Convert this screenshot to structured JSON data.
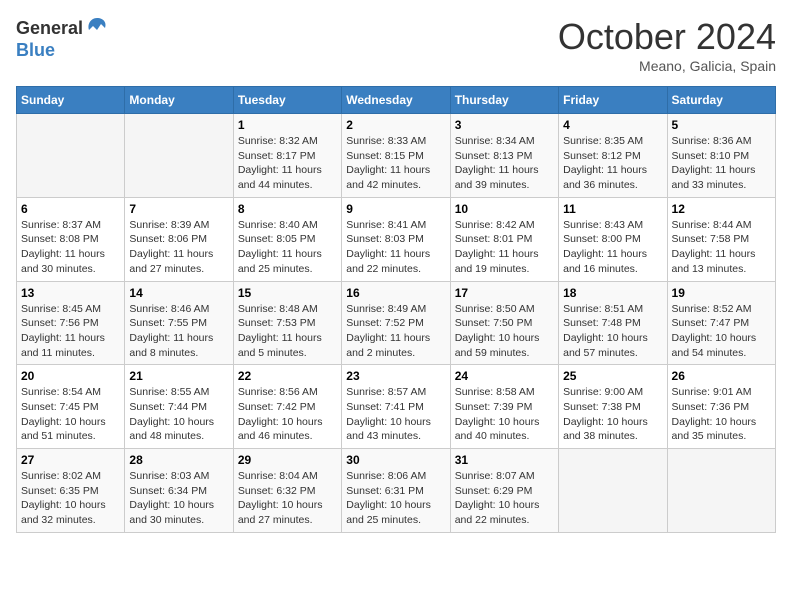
{
  "header": {
    "logo_general": "General",
    "logo_blue": "Blue",
    "month": "October 2024",
    "location": "Meano, Galicia, Spain"
  },
  "weekdays": [
    "Sunday",
    "Monday",
    "Tuesday",
    "Wednesday",
    "Thursday",
    "Friday",
    "Saturday"
  ],
  "weeks": [
    [
      {
        "day": "",
        "info": ""
      },
      {
        "day": "",
        "info": ""
      },
      {
        "day": "1",
        "info": "Sunrise: 8:32 AM\nSunset: 8:17 PM\nDaylight: 11 hours and 44 minutes."
      },
      {
        "day": "2",
        "info": "Sunrise: 8:33 AM\nSunset: 8:15 PM\nDaylight: 11 hours and 42 minutes."
      },
      {
        "day": "3",
        "info": "Sunrise: 8:34 AM\nSunset: 8:13 PM\nDaylight: 11 hours and 39 minutes."
      },
      {
        "day": "4",
        "info": "Sunrise: 8:35 AM\nSunset: 8:12 PM\nDaylight: 11 hours and 36 minutes."
      },
      {
        "day": "5",
        "info": "Sunrise: 8:36 AM\nSunset: 8:10 PM\nDaylight: 11 hours and 33 minutes."
      }
    ],
    [
      {
        "day": "6",
        "info": "Sunrise: 8:37 AM\nSunset: 8:08 PM\nDaylight: 11 hours and 30 minutes."
      },
      {
        "day": "7",
        "info": "Sunrise: 8:39 AM\nSunset: 8:06 PM\nDaylight: 11 hours and 27 minutes."
      },
      {
        "day": "8",
        "info": "Sunrise: 8:40 AM\nSunset: 8:05 PM\nDaylight: 11 hours and 25 minutes."
      },
      {
        "day": "9",
        "info": "Sunrise: 8:41 AM\nSunset: 8:03 PM\nDaylight: 11 hours and 22 minutes."
      },
      {
        "day": "10",
        "info": "Sunrise: 8:42 AM\nSunset: 8:01 PM\nDaylight: 11 hours and 19 minutes."
      },
      {
        "day": "11",
        "info": "Sunrise: 8:43 AM\nSunset: 8:00 PM\nDaylight: 11 hours and 16 minutes."
      },
      {
        "day": "12",
        "info": "Sunrise: 8:44 AM\nSunset: 7:58 PM\nDaylight: 11 hours and 13 minutes."
      }
    ],
    [
      {
        "day": "13",
        "info": "Sunrise: 8:45 AM\nSunset: 7:56 PM\nDaylight: 11 hours and 11 minutes."
      },
      {
        "day": "14",
        "info": "Sunrise: 8:46 AM\nSunset: 7:55 PM\nDaylight: 11 hours and 8 minutes."
      },
      {
        "day": "15",
        "info": "Sunrise: 8:48 AM\nSunset: 7:53 PM\nDaylight: 11 hours and 5 minutes."
      },
      {
        "day": "16",
        "info": "Sunrise: 8:49 AM\nSunset: 7:52 PM\nDaylight: 11 hours and 2 minutes."
      },
      {
        "day": "17",
        "info": "Sunrise: 8:50 AM\nSunset: 7:50 PM\nDaylight: 10 hours and 59 minutes."
      },
      {
        "day": "18",
        "info": "Sunrise: 8:51 AM\nSunset: 7:48 PM\nDaylight: 10 hours and 57 minutes."
      },
      {
        "day": "19",
        "info": "Sunrise: 8:52 AM\nSunset: 7:47 PM\nDaylight: 10 hours and 54 minutes."
      }
    ],
    [
      {
        "day": "20",
        "info": "Sunrise: 8:54 AM\nSunset: 7:45 PM\nDaylight: 10 hours and 51 minutes."
      },
      {
        "day": "21",
        "info": "Sunrise: 8:55 AM\nSunset: 7:44 PM\nDaylight: 10 hours and 48 minutes."
      },
      {
        "day": "22",
        "info": "Sunrise: 8:56 AM\nSunset: 7:42 PM\nDaylight: 10 hours and 46 minutes."
      },
      {
        "day": "23",
        "info": "Sunrise: 8:57 AM\nSunset: 7:41 PM\nDaylight: 10 hours and 43 minutes."
      },
      {
        "day": "24",
        "info": "Sunrise: 8:58 AM\nSunset: 7:39 PM\nDaylight: 10 hours and 40 minutes."
      },
      {
        "day": "25",
        "info": "Sunrise: 9:00 AM\nSunset: 7:38 PM\nDaylight: 10 hours and 38 minutes."
      },
      {
        "day": "26",
        "info": "Sunrise: 9:01 AM\nSunset: 7:36 PM\nDaylight: 10 hours and 35 minutes."
      }
    ],
    [
      {
        "day": "27",
        "info": "Sunrise: 8:02 AM\nSunset: 6:35 PM\nDaylight: 10 hours and 32 minutes."
      },
      {
        "day": "28",
        "info": "Sunrise: 8:03 AM\nSunset: 6:34 PM\nDaylight: 10 hours and 30 minutes."
      },
      {
        "day": "29",
        "info": "Sunrise: 8:04 AM\nSunset: 6:32 PM\nDaylight: 10 hours and 27 minutes."
      },
      {
        "day": "30",
        "info": "Sunrise: 8:06 AM\nSunset: 6:31 PM\nDaylight: 10 hours and 25 minutes."
      },
      {
        "day": "31",
        "info": "Sunrise: 8:07 AM\nSunset: 6:29 PM\nDaylight: 10 hours and 22 minutes."
      },
      {
        "day": "",
        "info": ""
      },
      {
        "day": "",
        "info": ""
      }
    ]
  ]
}
